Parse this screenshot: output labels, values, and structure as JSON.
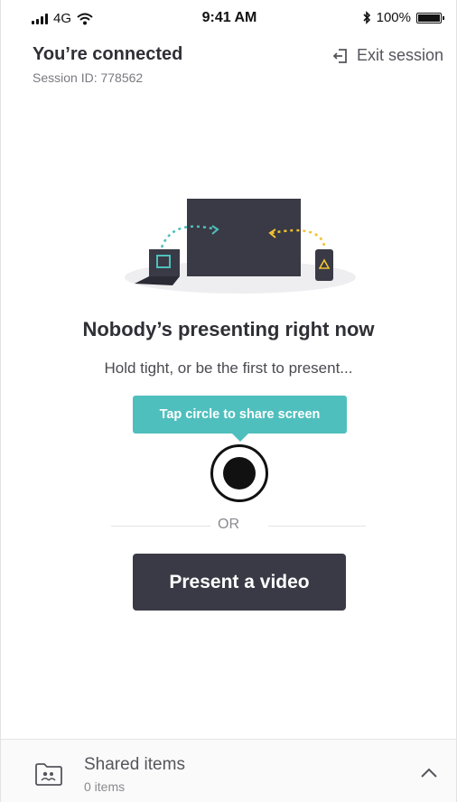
{
  "status_bar": {
    "carrier": "4G",
    "time": "9:41 AM",
    "battery": "100%",
    "battery_level": 1.0
  },
  "header": {
    "title": "You’re connected",
    "session_id": "Session ID: 778562",
    "exit_label": "Exit session"
  },
  "main": {
    "headline": "Nobody’s presenting right now",
    "subline": "Hold tight, or be the first to present...",
    "tooltip": "Tap circle to share screen",
    "or_label": "OR",
    "present_video_label": "Present a video"
  },
  "shared": {
    "title": "Shared items",
    "count": "0 items"
  },
  "colors": {
    "accent_teal": "#4fbfbd",
    "accent_yellow": "#f2c230",
    "button_dark": "#393a45"
  },
  "icons": {
    "signal": "signal-bars-icon",
    "wifi": "wifi-icon",
    "bluetooth": "bluetooth-icon",
    "battery": "battery-icon",
    "exit": "exit-icon",
    "record": "record-icon",
    "shared_folder": "shared-folder-icon",
    "chevron": "chevron-up-icon"
  }
}
